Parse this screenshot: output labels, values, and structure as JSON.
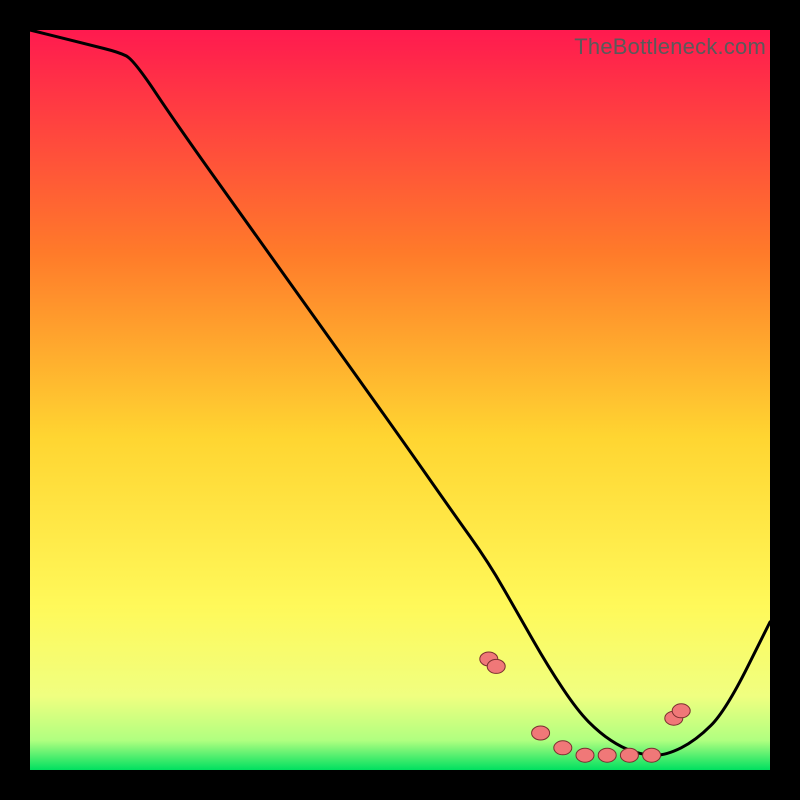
{
  "watermark": "TheBottleneck.com",
  "colors": {
    "bg_black": "#000000",
    "grad_top": "#ff1a4f",
    "grad_mid1": "#ff9a2a",
    "grad_mid2": "#ffe931",
    "grad_low": "#f8ff6e",
    "grad_bottom": "#00e060",
    "curve": "#000000",
    "dot_fill": "#f07878",
    "dot_stroke": "#7a2f2f"
  },
  "chart_data": {
    "type": "line",
    "title": "",
    "xlabel": "",
    "ylabel": "",
    "xlim": [
      0,
      100
    ],
    "ylim": [
      0,
      100
    ],
    "x": [
      0,
      4,
      8,
      12,
      14,
      20,
      30,
      40,
      50,
      57,
      62,
      66,
      70,
      74,
      77,
      80,
      83,
      86,
      90,
      94,
      100
    ],
    "y": [
      100,
      99,
      98,
      97,
      96,
      87,
      73,
      59,
      45,
      35,
      28,
      21,
      14,
      8,
      5,
      3,
      2,
      2,
      4,
      8,
      20
    ],
    "dots_x": [
      62,
      63,
      69,
      72,
      75,
      78,
      81,
      84,
      87,
      88
    ],
    "dots_y": [
      15,
      14,
      5,
      3,
      2,
      2,
      2,
      2,
      7,
      8
    ]
  }
}
